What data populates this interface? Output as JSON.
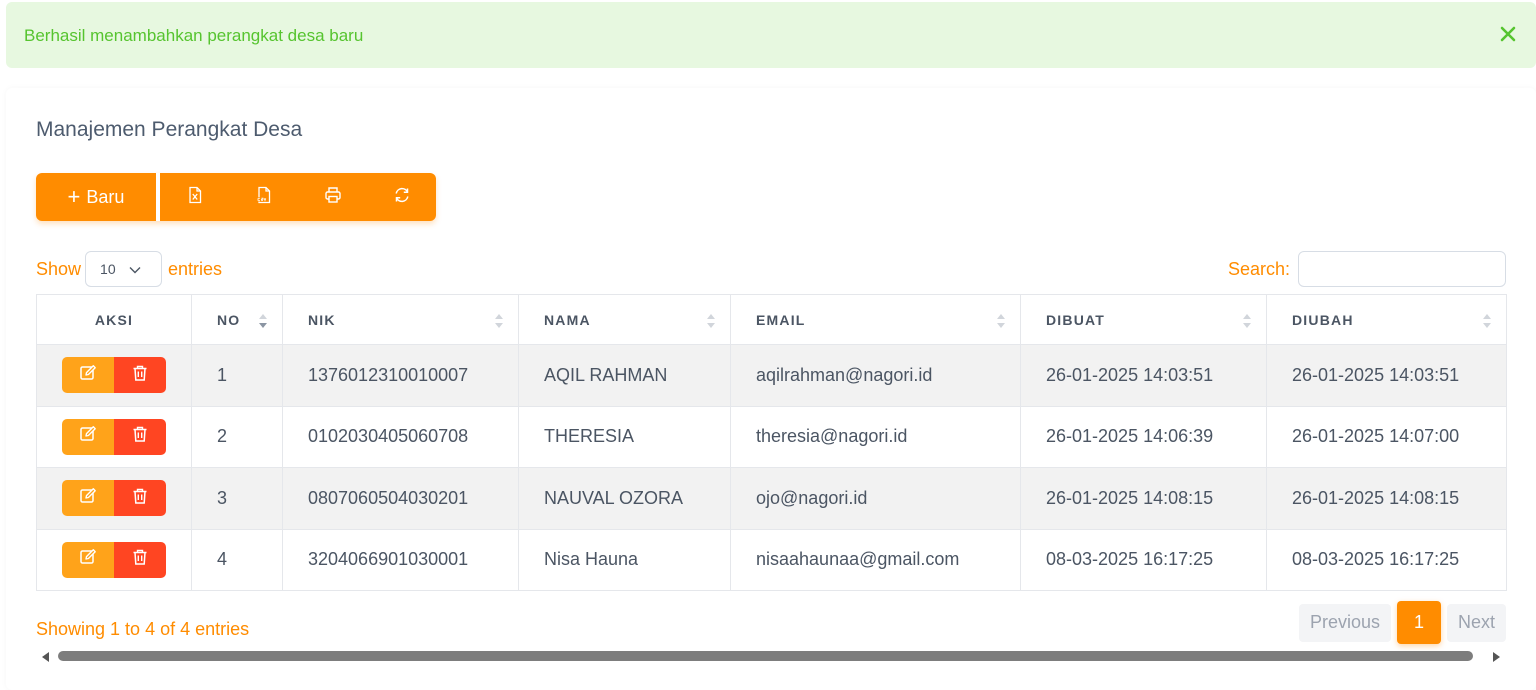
{
  "alert": {
    "message": "Berhasil menambahkan perangkat desa baru",
    "close_icon": "close-icon"
  },
  "card": {
    "title": "Manajemen Perangkat Desa"
  },
  "toolbar": {
    "new_label": "Baru",
    "buttons": [
      {
        "icon": "excel-file-icon"
      },
      {
        "icon": "csv-file-icon"
      },
      {
        "icon": "printer-icon"
      },
      {
        "icon": "refresh-icon"
      }
    ]
  },
  "length": {
    "show_label": "Show",
    "value": "10",
    "entries_label": "entries"
  },
  "search": {
    "label": "Search:",
    "value": ""
  },
  "table": {
    "columns": [
      "AKSI",
      "NO",
      "NIK",
      "NAMA",
      "EMAIL",
      "DIBUAT",
      "DIUBAH"
    ],
    "rows": [
      {
        "no": "1",
        "nik": "1376012310010007",
        "nama": "AQIL RAHMAN",
        "email": "aqilrahman@nagori.id",
        "dibuat": "26-01-2025 14:03:51",
        "diubah": "26-01-2025 14:03:51"
      },
      {
        "no": "2",
        "nik": "0102030405060708",
        "nama": "THERESIA",
        "email": "theresia@nagori.id",
        "dibuat": "26-01-2025 14:06:39",
        "diubah": "26-01-2025 14:07:00"
      },
      {
        "no": "3",
        "nik": "0807060504030201",
        "nama": "NAUVAL OZORA",
        "email": "ojo@nagori.id",
        "dibuat": "26-01-2025 14:08:15",
        "diubah": "26-01-2025 14:08:15"
      },
      {
        "no": "4",
        "nik": "3204066901030001",
        "nama": "Nisa Hauna",
        "email": "nisaahaunaa@gmail.com",
        "dibuat": "08-03-2025 16:17:25",
        "diubah": "08-03-2025 16:17:25"
      }
    ]
  },
  "footer": {
    "info": "Showing 1 to 4 of 4 entries",
    "previous": "Previous",
    "current_page": "1",
    "next": "Next"
  },
  "colors": {
    "accent": "#ff8c00",
    "edit": "#ffa31a",
    "delete": "#ff4522",
    "alert_bg": "#e7f8e0",
    "alert_text": "#56c42f"
  }
}
